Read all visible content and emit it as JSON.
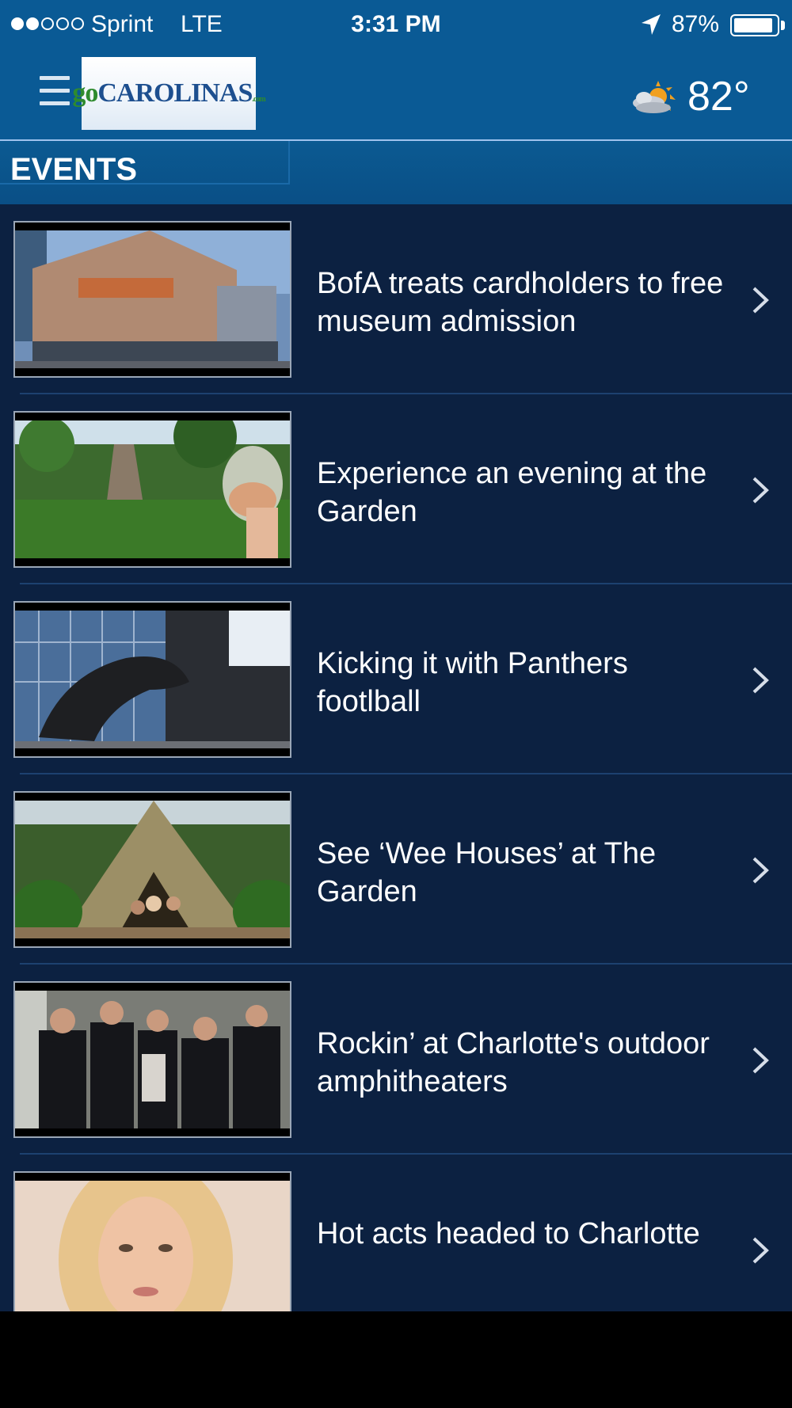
{
  "status_bar": {
    "carrier": "Sprint",
    "network": "LTE",
    "time": "3:31 PM",
    "battery_percent": "87%",
    "signal_bars_filled": 2,
    "signal_bars_total": 5
  },
  "header": {
    "logo_text_go": "go",
    "logo_text_main": "CAROLINAS",
    "logo_text_suffix": ".com",
    "weather_icon": "partly-cloudy-icon",
    "temperature": "82°"
  },
  "section": {
    "title": "EVENTS"
  },
  "events": [
    {
      "title": "BofA treats cardholders to free museum admission",
      "thumb_theme": "museum"
    },
    {
      "title": "Experience an evening at the Garden",
      "thumb_theme": "garden-wine"
    },
    {
      "title": "Kicking it with Panthers footlball",
      "thumb_theme": "panther-statue"
    },
    {
      "title": "See ‘Wee Houses’ at The Garden",
      "thumb_theme": "wee-house"
    },
    {
      "title": "Rockin’ at Charlotte's outdoor amphitheaters",
      "thumb_theme": "band"
    },
    {
      "title": "Hot acts headed to Charlotte",
      "thumb_theme": "singer"
    }
  ],
  "colors": {
    "header_blue": "#0a5a95",
    "list_bg": "#0c2141",
    "divider": "#1d4170"
  }
}
